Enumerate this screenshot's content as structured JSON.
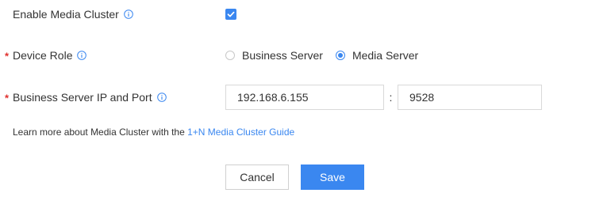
{
  "form": {
    "enable_cluster": {
      "label": "Enable Media Cluster",
      "checked": true,
      "icon": "info-icon"
    },
    "device_role": {
      "label": "Device Role",
      "required_mark": "*",
      "icon": "info-icon",
      "options": [
        {
          "label": "Business Server",
          "selected": false
        },
        {
          "label": "Media Server",
          "selected": true
        }
      ]
    },
    "server_ip_port": {
      "label": "Business Server IP and Port",
      "required_mark": "*",
      "icon": "info-icon",
      "ip_value": "192.168.6.155",
      "separator": ":",
      "port_value": "9528"
    }
  },
  "learn_more": {
    "text": "Learn more about Media Cluster with the ",
    "link_text": "1+N Media Cluster Guide"
  },
  "buttons": {
    "cancel_label": "Cancel",
    "save_label": "Save"
  },
  "colors": {
    "accent": "#3a87f0",
    "required": "#e0302d",
    "text": "#333333",
    "border": "#d9d9d9"
  }
}
